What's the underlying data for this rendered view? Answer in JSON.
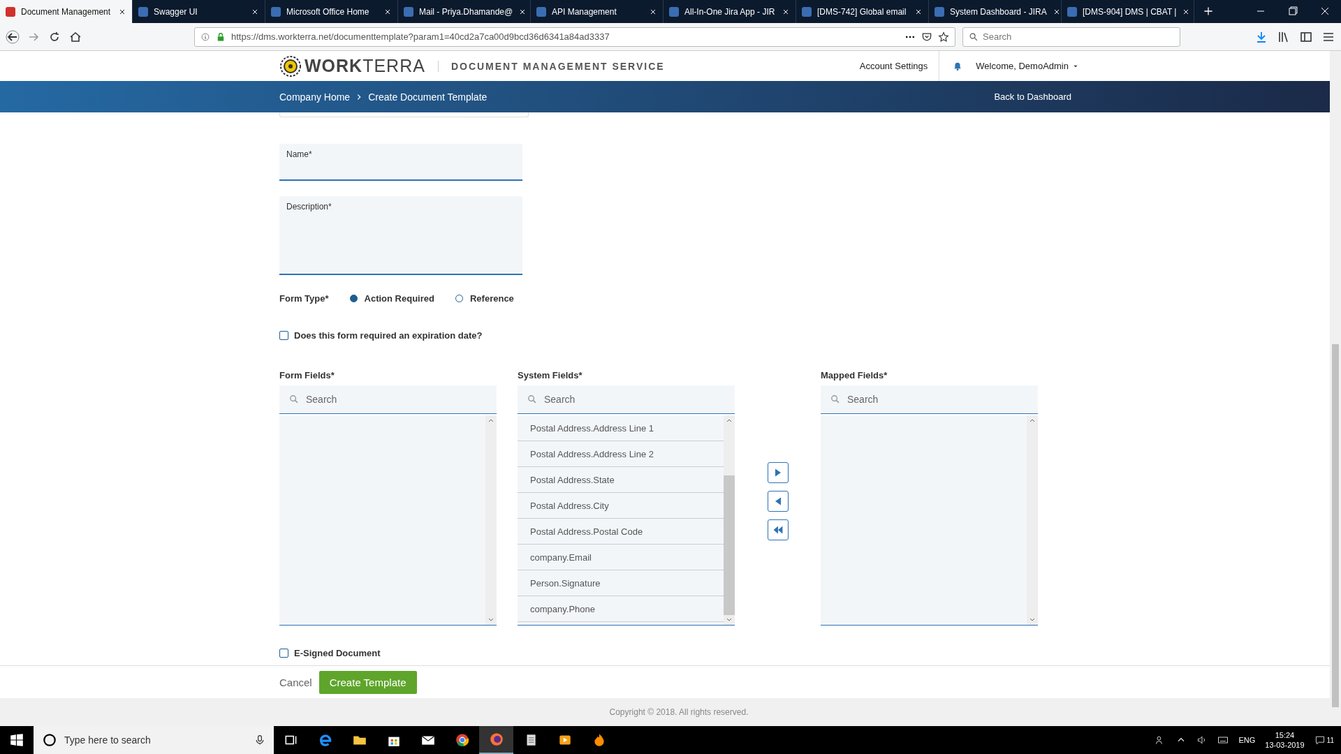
{
  "browser": {
    "tabs": [
      {
        "title": "Document Management",
        "selected": true
      },
      {
        "title": "Swagger UI",
        "selected": false
      },
      {
        "title": "Microsoft Office Home",
        "selected": false
      },
      {
        "title": "Mail - Priya.Dhamande@",
        "selected": false
      },
      {
        "title": "API Management",
        "selected": false
      },
      {
        "title": "All-In-One Jira App - JIR",
        "selected": false
      },
      {
        "title": "[DMS-742] Global email",
        "selected": false
      },
      {
        "title": "System Dashboard - JIRA",
        "selected": false
      },
      {
        "title": "[DMS-904] DMS | CBAT |",
        "selected": false
      }
    ],
    "url": "https://dms.workterra.net/documenttemplate?param1=40cd2a7ca00d9bcd36d6341a84ad3337",
    "search_placeholder": "Search"
  },
  "header": {
    "logo": "**WORK**TERRA",
    "service": "DOCUMENT MANAGEMENT SERVICE",
    "account_settings": "Account Settings",
    "welcome": "Welcome, DemoAdmin"
  },
  "breadcrumb": {
    "items": [
      "Company Home",
      "Create Document Template"
    ],
    "back": "Back to Dashboard"
  },
  "form": {
    "name_label": "Name*",
    "description_label": "Description*",
    "form_type": {
      "label": "Form Type*",
      "options": [
        {
          "label": "Action Required",
          "selected": true
        },
        {
          "label": "Reference",
          "selected": false
        }
      ]
    },
    "expiration": {
      "label": "Does this form required an expiration date?",
      "checked": false
    },
    "lists": [
      {
        "label": "Form Fields*",
        "placeholder": "Search"
      },
      {
        "label": "System Fields*",
        "placeholder": "Search",
        "items": [
          "Postal Address.Address Line 1",
          "Postal Address.Address Line 2",
          "Postal Address.State",
          "Postal Address.City",
          "Postal Address.Postal Code",
          "company.Email",
          "Person.Signature",
          "company.Phone"
        ]
      },
      {
        "label": "Mapped Fields*",
        "placeholder": "Search"
      }
    ],
    "esigned": {
      "label": "E-Signed Document",
      "checked": false
    },
    "cancel": "Cancel",
    "create": "Create Template"
  },
  "footer": "Copyright © 2018. All rights reserved.",
  "taskbar": {
    "search_placeholder": "Type here to search",
    "language": "ENG",
    "time": "15:24",
    "date": "13-03-2019",
    "notifications": "11"
  }
}
